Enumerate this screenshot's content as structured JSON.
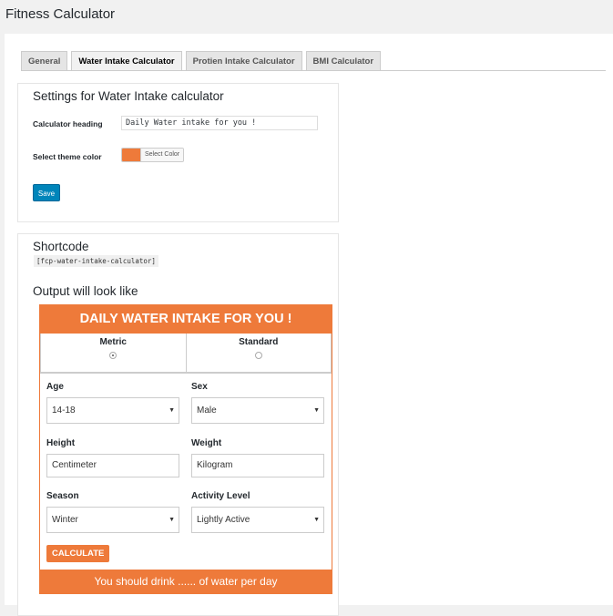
{
  "page": {
    "title": "Fitness Calculator"
  },
  "tabs": [
    {
      "label": "General",
      "active": false
    },
    {
      "label": "Water Intake Calculator",
      "active": true
    },
    {
      "label": "Protien Intake Calculator",
      "active": false
    },
    {
      "label": "BMI Calculator",
      "active": false
    }
  ],
  "settings": {
    "heading": "Settings for Water Intake calculator",
    "calculator_heading_label": "Calculator heading",
    "calculator_heading_value": "Daily Water intake for you !",
    "theme_color_label": "Select theme color",
    "theme_color": "#ee7a3a",
    "select_color_label": "Select Color",
    "save_label": "Save"
  },
  "shortcode": {
    "heading": "Shortcode",
    "code": "[fcp-water-intake-calculator]",
    "output_heading": "Output will look like"
  },
  "preview": {
    "title": "DAILY WATER INTAKE FOR YOU !",
    "units": [
      {
        "label": "Metric",
        "selected": true
      },
      {
        "label": "Standard",
        "selected": false
      }
    ],
    "age_label": "Age",
    "age_value": "14-18",
    "sex_label": "Sex",
    "sex_value": "Male",
    "height_label": "Height",
    "height_placeholder": "Centimeter",
    "weight_label": "Weight",
    "weight_placeholder": "Kilogram",
    "season_label": "Season",
    "season_value": "Winter",
    "activity_label": "Activity Level",
    "activity_value": "Lightly Active",
    "calculate_label": "CALCULATE",
    "result_text": "You should drink ...... of water per day"
  },
  "colors": {
    "accent": "#ee7a3a",
    "wp_button": "#0085ba"
  }
}
